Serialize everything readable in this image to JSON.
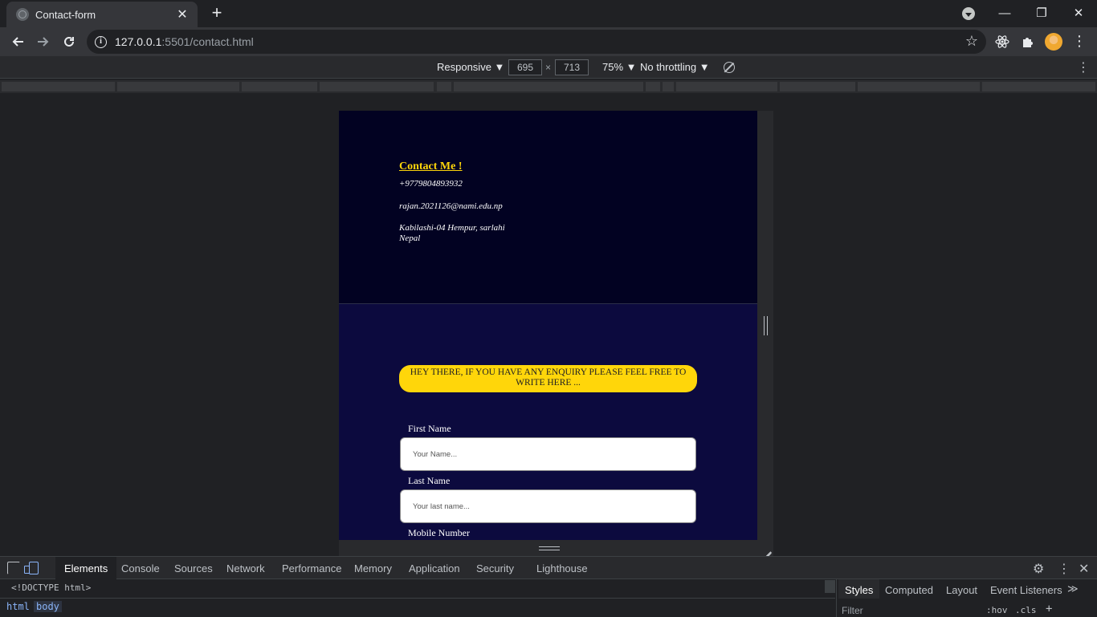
{
  "browser": {
    "tab_title": "Contact-form",
    "tab_close": "✕",
    "new_tab": "+",
    "url_host": "127.0.0.1",
    "url_rest": ":5501/contact.html",
    "window": {
      "minimize": "—",
      "restore": "❐",
      "close": "✕"
    }
  },
  "device_toolbar": {
    "device": "Responsive ▼",
    "width": "695",
    "height": "713",
    "times": "×",
    "zoom": "75% ▼",
    "throttling": "No throttling ▼"
  },
  "page": {
    "heading": "Contact Me !",
    "phone": "+9779804893932",
    "email": "rajan.2021126@nami.edu.np",
    "address_line1": "Kabilashi-04 Hempur, sarlahi",
    "address_line2": "Nepal",
    "banner": "HEY THERE, IF YOU HAVE ANY ENQUIRY PLEASE FEEL FREE TO WRITE HERE ...",
    "fields": [
      {
        "label": "First Name",
        "placeholder": "Your Name..."
      },
      {
        "label": "Last Name",
        "placeholder": "Your last name..."
      },
      {
        "label": "Mobile Number"
      }
    ]
  },
  "devtools": {
    "tabs": [
      "Elements",
      "Console",
      "Sources",
      "Network",
      "Performance",
      "Memory",
      "Application",
      "Security",
      "Lighthouse"
    ],
    "doctype": "<!DOCTYPE html>",
    "breadcrumbs": [
      "html",
      "body"
    ],
    "styles_tabs": [
      "Styles",
      "Computed",
      "Layout",
      "Event Listeners"
    ],
    "more": "≫",
    "filter_placeholder": "Filter",
    "hov": ":hov",
    "cls": ".cls",
    "add": "+"
  },
  "colors": {
    "accent_yellow": "#ffd60a",
    "hero_bg": "#020222",
    "form_bg": "#0c0a3e"
  }
}
